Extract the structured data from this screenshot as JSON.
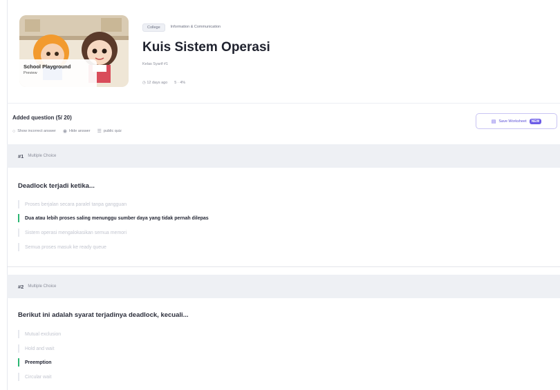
{
  "quiz": {
    "thumbnail": {
      "title": "School Playground",
      "subtitle": "Preview"
    },
    "tags": {
      "level": "College",
      "subject": "Information & Communication"
    },
    "title": "Kuis Sistem Operasi",
    "grade": "Kelas Syarif #1",
    "meta": {
      "time": "12 days ago",
      "plays": "5 · 4%"
    }
  },
  "toolbar": {
    "added_label": "Added question (5/ 20)",
    "toggles": [
      {
        "icon": "circle-toggle-icon",
        "label": "Show incorrect answer"
      },
      {
        "icon": "eye-icon",
        "label": "Hide answer"
      },
      {
        "icon": "list-icon",
        "label": "public quiz"
      }
    ],
    "save_button": {
      "label": "Save Worksheet",
      "badge": "NEW"
    }
  },
  "questions": [
    {
      "number": "#1",
      "type": "Multiple Choice",
      "text": "Deadlock terjadi ketika...",
      "options": [
        {
          "text": "Proses berjalan secara paralel tanpa gangguan",
          "correct": false
        },
        {
          "text": "Dua atau lebih proses saling menunggu sumber daya yang tidak pernah dilepas",
          "correct": true
        },
        {
          "text": "Sistem operasi mengalokasikan semua memori",
          "correct": false
        },
        {
          "text": "Semua proses masuk ke ready queue",
          "correct": false
        }
      ]
    },
    {
      "number": "#2",
      "type": "Multiple Choice",
      "text": "Berikut ini adalah syarat terjadinya deadlock, kecuali...",
      "options": [
        {
          "text": "Mutual exclusion",
          "correct": false
        },
        {
          "text": "Hold and wait",
          "correct": false
        },
        {
          "text": "Preemption",
          "correct": true
        },
        {
          "text": "Circular wait",
          "correct": false
        }
      ]
    }
  ],
  "colors": {
    "accent": "#6c5ce7",
    "correct": "#2bb673",
    "header_bg": "#eef0f4"
  }
}
